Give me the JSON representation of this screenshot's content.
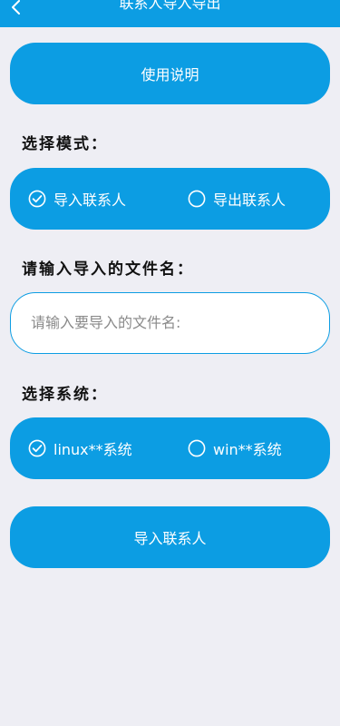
{
  "header": {
    "title": "联系人导入导出",
    "back_icon": "chevron-left-icon"
  },
  "instructions_button": {
    "label": "使用说明"
  },
  "mode_section": {
    "label": "选择模式：",
    "options": [
      {
        "label": "导入联系人",
        "selected": true
      },
      {
        "label": "导出联系人",
        "selected": false
      }
    ]
  },
  "filename_section": {
    "label": "请输入导入的文件名：",
    "input_value": "",
    "placeholder": "请输入要导入的文件名:"
  },
  "system_section": {
    "label": "选择系统：",
    "options": [
      {
        "label": "linux**系统",
        "selected": true
      },
      {
        "label": "win**系统",
        "selected": false
      }
    ]
  },
  "action_button": {
    "label": "导入联系人"
  },
  "colors": {
    "accent": "#0c9de3",
    "background": "#eeeef4",
    "text_on_accent": "#ffffff"
  }
}
